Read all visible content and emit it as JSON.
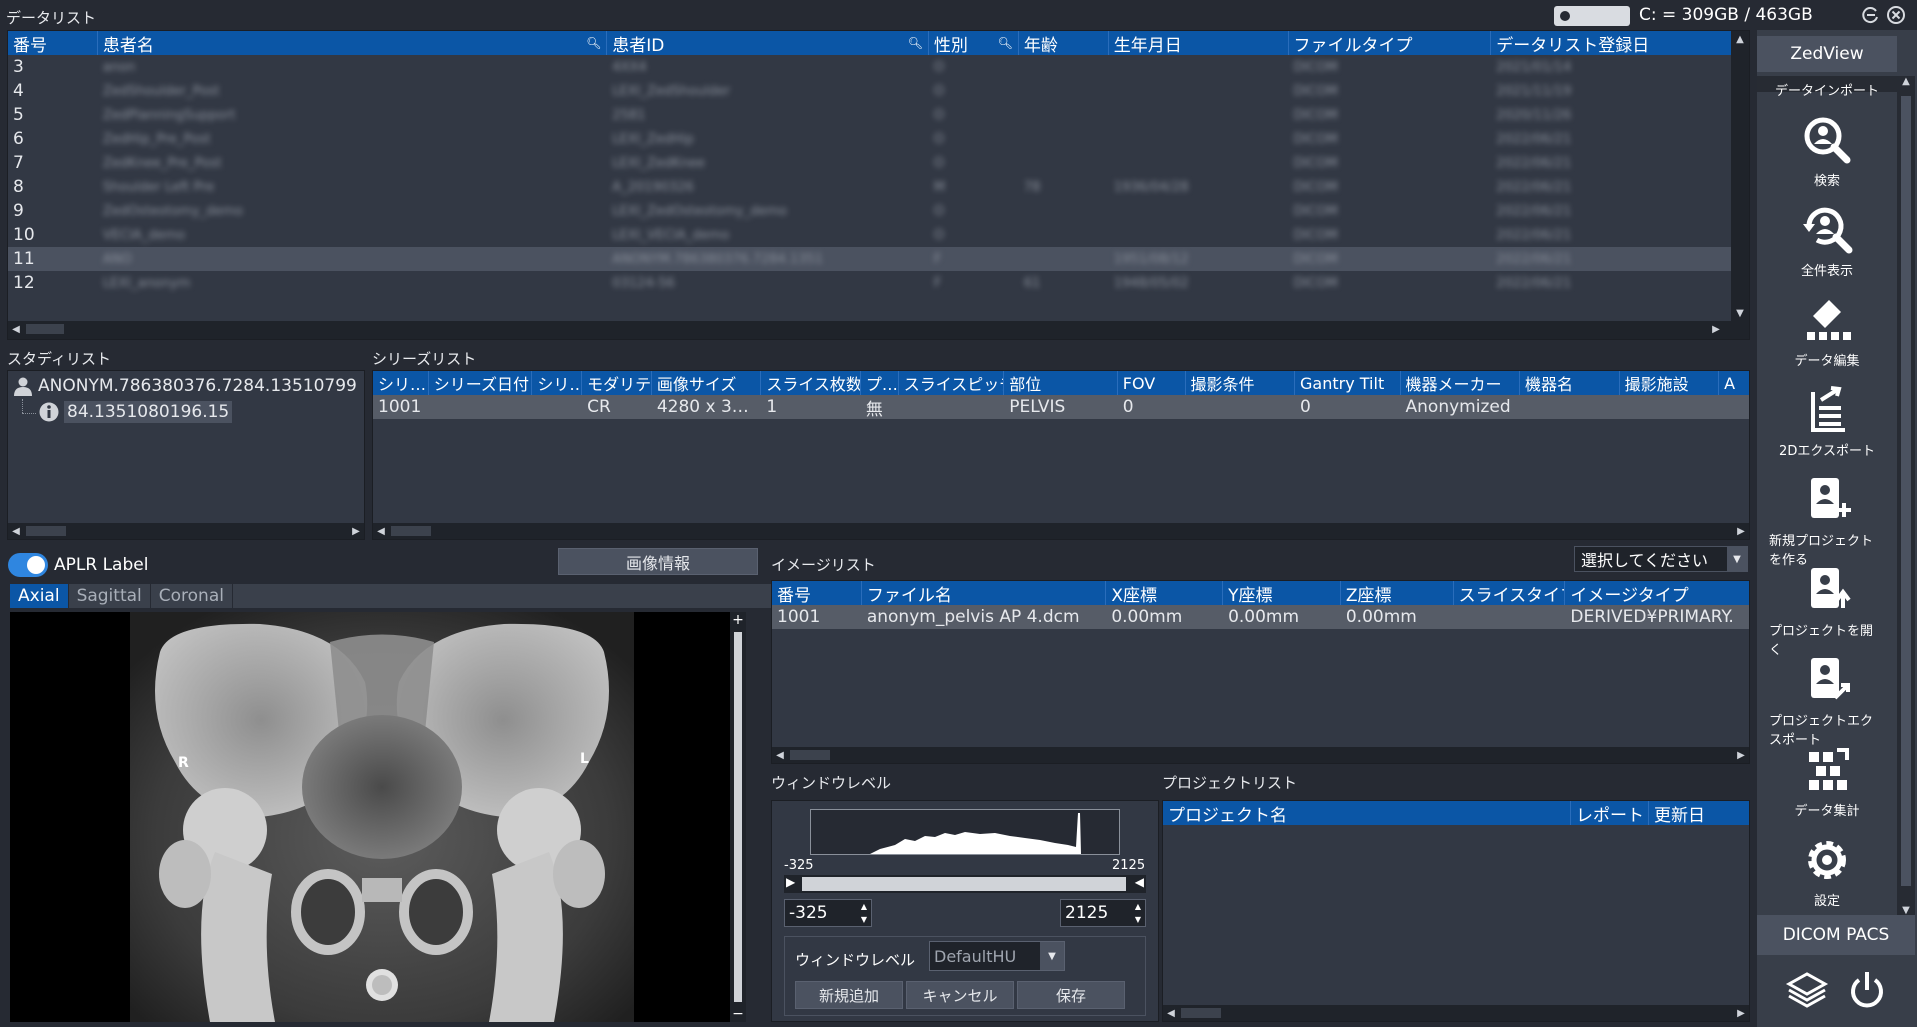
{
  "top": {
    "datalist_title": "データリスト",
    "disk": "C: = 309GB / 463GB"
  },
  "datalist": {
    "columns": [
      "番号",
      "患者名",
      "患者ID",
      "性別",
      "年齢",
      "生年月日",
      "ファイルタイプ",
      "データリスト登録日"
    ],
    "rows": [
      {
        "no": "3",
        "name": "anon",
        "pid": "4XX4",
        "sex": "O",
        "age": "",
        "dob": "",
        "type": "DICOM",
        "date": "2021/01/14"
      },
      {
        "no": "4",
        "name": "ZedShoulder_Post",
        "pid": "LEXI_ZedShoulder",
        "sex": "O",
        "age": "",
        "dob": "",
        "type": "DICOM",
        "date": "2021/11/19"
      },
      {
        "no": "5",
        "name": "ZedPlanningSupport",
        "pid": "2581",
        "sex": "O",
        "age": "",
        "dob": "",
        "type": "DICOM",
        "date": "2020/11/26"
      },
      {
        "no": "6",
        "name": "ZedHip_Pre_Post",
        "pid": "LEXI_ZedHip",
        "sex": "O",
        "age": "",
        "dob": "",
        "type": "DICOM",
        "date": "2022/06/21"
      },
      {
        "no": "7",
        "name": "ZedKnee_Pre_Post",
        "pid": "LEXI_ZedKnee",
        "sex": "O",
        "age": "",
        "dob": "",
        "type": "DICOM",
        "date": "2022/06/21"
      },
      {
        "no": "8",
        "name": "Shoulder Left Pre",
        "pid": "A_20190326",
        "sex": "M",
        "age": "78",
        "dob": "1936/04/28",
        "type": "DICOM",
        "date": "2022/06/21"
      },
      {
        "no": "9",
        "name": "ZedOsteotomy_demo",
        "pid": "LEXI_ZedOsteotomy_demo",
        "sex": "O",
        "age": "",
        "dob": "",
        "type": "DICOM",
        "date": "2022/06/21"
      },
      {
        "no": "10",
        "name": "VECIA_demo",
        "pid": "LEXI_VECIA_demo",
        "sex": "O",
        "age": "",
        "dob": "",
        "type": "DICOM",
        "date": "2022/06/21"
      },
      {
        "no": "11",
        "name": "ANO",
        "pid": "ANONYM.786380376.7284.1351",
        "sex": "F",
        "age": "",
        "dob": "1951/08/12",
        "type": "DICOM",
        "date": "2022/06/21"
      },
      {
        "no": "12",
        "name": "LEXI_anonym",
        "pid": "03124-56",
        "sex": "F",
        "age": "61",
        "dob": "1948/05/02",
        "type": "DICOM",
        "date": "2022/06/21"
      }
    ]
  },
  "study": {
    "title": "スタディリスト",
    "root": "ANONYM.786380376.7284.13510799",
    "child": "84.1351080196.15"
  },
  "series": {
    "title": "シリーズリスト",
    "columns": [
      "シリ…",
      "シリーズ日付",
      "シリ…",
      "モダリティ",
      "画像サイズ",
      "スライス枚数",
      "プ…",
      "スライスピッチ",
      "部位",
      "FOV",
      "撮影条件",
      "Gantry Tilt",
      "機器メーカー",
      "機器名",
      "撮影施設",
      "A"
    ],
    "row": [
      "1001",
      "",
      "",
      "CR",
      "4280 x 3…",
      "1",
      "無",
      "",
      "PELVIS",
      "0",
      "",
      "0",
      "Anonymized",
      "",
      "",
      ""
    ]
  },
  "viewer": {
    "toggle_label": "APLR Label",
    "info_button": "画像情報",
    "tabs": [
      "Axial",
      "Sagittal",
      "Coronal"
    ],
    "mark_r": "R",
    "mark_l": "L"
  },
  "imagelist": {
    "title": "イメージリスト",
    "select": "選択してください",
    "columns": [
      "番号",
      "ファイル名",
      "X座標",
      "Y座標",
      "Z座標",
      "スライスタイプ",
      "イメージタイプ"
    ],
    "row": [
      "1001",
      "anonym_pelvis AP 4.dcm",
      "0.00mm",
      "0.00mm",
      "0.00mm",
      "",
      "DERIVED¥PRIMARY."
    ]
  },
  "window": {
    "title": "ウィンドウレベル",
    "min": "-325",
    "max": "2125",
    "low_value": "-325",
    "high_value": "2125",
    "preset_label": "ウィンドウレベル",
    "preset_value": "DefaultHU",
    "btn_add": "新規追加",
    "btn_cancel": "キャンセル",
    "btn_save": "保存"
  },
  "project": {
    "title": "プロジェクトリスト",
    "columns": [
      "プロジェクト名",
      "レポート",
      "更新日"
    ]
  },
  "sidebar": {
    "app": "ZedView",
    "section": "データインポート",
    "items": [
      "検索",
      "全件表示",
      "データ編集",
      "2Dエクスポート",
      "新規プロジェクトを作る",
      "プロジェクトを開く",
      "プロジェクトエクスポート",
      "データ集計",
      "設定"
    ],
    "pacs": "DICOM PACS"
  }
}
